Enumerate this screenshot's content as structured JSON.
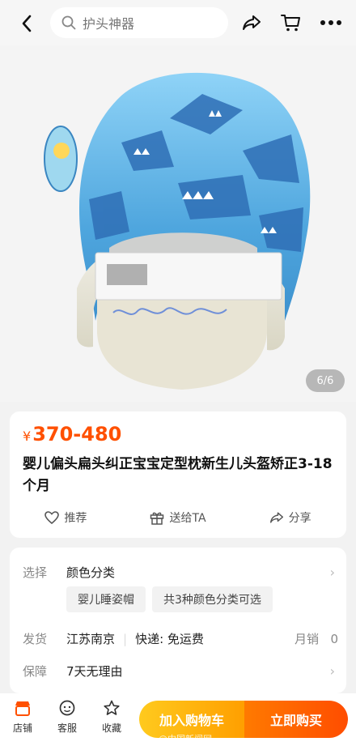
{
  "header": {
    "search_placeholder": "护头神器",
    "icons": [
      "back-icon",
      "search-icon",
      "share-icon",
      "cart-icon",
      "more-icon"
    ]
  },
  "hero": {
    "pager": "6/6",
    "image_subject": "baby-helmet"
  },
  "product": {
    "currency": "¥",
    "price": "370-480",
    "title": "婴儿偏头扁头纠正宝宝定型枕新生儿头盔矫正3-18个月",
    "actions": [
      {
        "label": "推荐",
        "icon": "heart-icon"
      },
      {
        "label": "送给TA",
        "icon": "gift-icon"
      },
      {
        "label": "分享",
        "icon": "share-icon"
      }
    ]
  },
  "spec": {
    "select_label": "选择",
    "select_value": "颜色分类",
    "chips": [
      "婴儿睡姿帽",
      "共3种颜色分类可选"
    ],
    "ship_label": "发货",
    "ship_from": "江苏南京",
    "delivery": "快递: 免运费",
    "monthly_sales_label": "月销",
    "monthly_sales": "0",
    "guarantee_label": "保障",
    "guarantee_value": "7天无理由"
  },
  "bottom": {
    "tabs": [
      {
        "label": "店铺",
        "icon": "store-icon"
      },
      {
        "label": "客服",
        "icon": "service-icon"
      },
      {
        "label": "收藏",
        "icon": "star-icon"
      }
    ],
    "add_to_cart": "加入购物车",
    "buy_now": "立即购买",
    "watermark": "@中国新闻网"
  },
  "colors": {
    "accent": "#ff5000",
    "cart_button": "#ffb300",
    "buy_button": "#ff5a00",
    "helmet_blue": "#5fb4e6"
  }
}
